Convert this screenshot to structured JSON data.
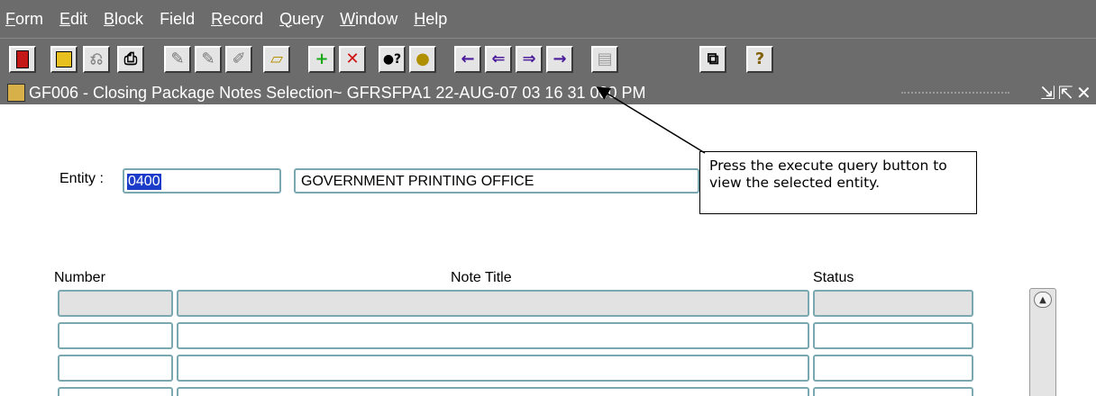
{
  "menu": [
    {
      "first": "F",
      "rest": "orm"
    },
    {
      "first": "E",
      "rest": "dit"
    },
    {
      "first": "B",
      "rest": "lock"
    },
    {
      "first": "Fi",
      "rest": "eld",
      "ul_index": 1
    },
    {
      "first": "R",
      "rest": "ecord"
    },
    {
      "first": "Q",
      "rest": "uery"
    },
    {
      "first": "W",
      "rest": "indow"
    },
    {
      "first": "H",
      "rest": "elp"
    }
  ],
  "toolbar_icons": [
    "exit-icon",
    "save-icon",
    "rollback-icon",
    "print-icon",
    "edit-icon",
    "edit2-icon",
    "edit3-icon",
    "clear-icon",
    "insert-record-icon",
    "delete-record-icon",
    "enter-query-icon",
    "execute-query-icon",
    "previous-block-icon",
    "previous-record-icon",
    "next-record-icon",
    "next-block-icon",
    "list-icon",
    "help-window-icon",
    "help-icon"
  ],
  "window": {
    "title": "GF006 - Closing Package Notes Selection~ GFRSFPA1  22-AUG-07 03 16 31 000 PM",
    "minimize": "⇲",
    "maximize": "⇱",
    "close": "✕"
  },
  "form": {
    "entity_label": "Entity :",
    "entity_value": "0400",
    "entity_name": "GOVERNMENT PRINTING OFFICE",
    "columns": {
      "number": "Number",
      "note_title": "Note Title",
      "status": "Status"
    }
  },
  "callout": {
    "text": "Press the execute query button to view the selected entity."
  },
  "colors": {
    "chrome": "#6c6c6c",
    "field_border": "#7aa8b0",
    "selection": "#1a3cc8"
  }
}
